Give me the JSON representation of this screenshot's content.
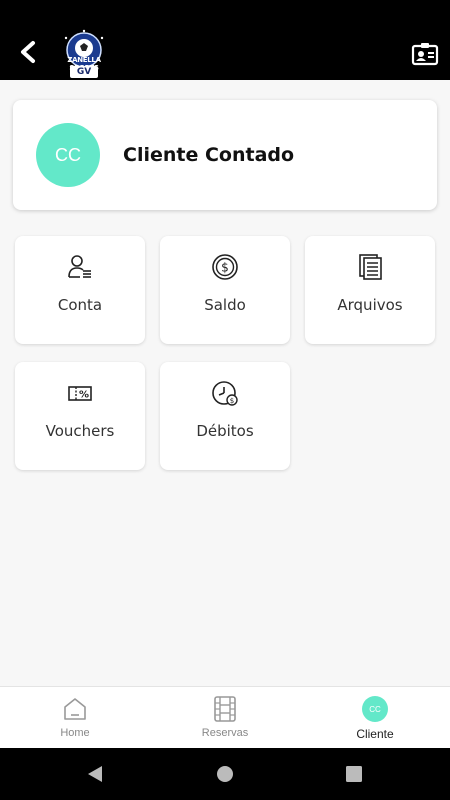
{
  "header": {
    "logo_text": "ZANELLA SPORTS",
    "logo_badge": "GV",
    "back_icon": "chevron-left-icon",
    "profile_icon": "id-card-icon"
  },
  "customer": {
    "initials": "CC",
    "name": "Cliente Contado",
    "avatar_color": "#63e8c9"
  },
  "menu": [
    {
      "label": "Conta",
      "icon": "user-list-icon"
    },
    {
      "label": "Saldo",
      "icon": "dollar-coin-icon"
    },
    {
      "label": "Arquivos",
      "icon": "documents-icon"
    },
    {
      "label": "Vouchers",
      "icon": "voucher-percent-icon"
    },
    {
      "label": "Débitos",
      "icon": "clock-debit-icon"
    }
  ],
  "bottom_nav": {
    "items": [
      {
        "label": "Home",
        "icon": "home-icon",
        "active": false
      },
      {
        "label": "Reservas",
        "icon": "film-calendar-icon",
        "active": false
      },
      {
        "label": "Cliente",
        "icon": "avatar",
        "active": true
      }
    ],
    "avatar_initials": "CC"
  },
  "system_nav": {
    "back": "triangle-back-icon",
    "home": "circle-home-icon",
    "recents": "square-recents-icon"
  }
}
